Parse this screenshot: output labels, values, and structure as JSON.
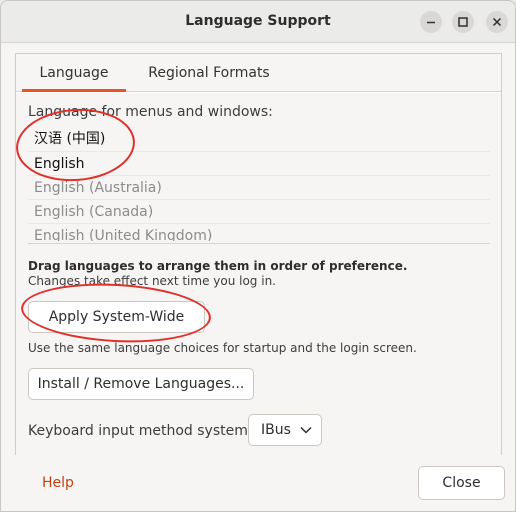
{
  "window": {
    "title": "Language Support",
    "controls": [
      "minimize-icon",
      "maximize-icon",
      "close-icon"
    ]
  },
  "tabs": [
    {
      "label": "Language",
      "selected": true
    },
    {
      "label": "Regional Formats",
      "selected": false
    }
  ],
  "language_tab": {
    "list_label": "Language for menus and windows:",
    "languages": [
      {
        "label": "汉语 (中国)",
        "active": true
      },
      {
        "label": "English",
        "active": true
      },
      {
        "label": "English (Australia)",
        "active": false
      },
      {
        "label": "English (Canada)",
        "active": false
      },
      {
        "label": "English (United Kingdom)",
        "active": false
      }
    ],
    "drag_hint": "Drag languages to arrange them in order of preference.",
    "effect_hint": "Changes take effect next time you log in.",
    "apply_button": "Apply System-Wide",
    "apply_hint": "Use the same language choices for startup and the login screen.",
    "install_button": "Install / Remove Languages...",
    "keyboard_label": "Keyboard input method system:",
    "keyboard_value": "IBus"
  },
  "footer": {
    "help_label": "Help",
    "close_label": "Close"
  },
  "colors": {
    "accent": "#e95420",
    "help_link": "#c34113",
    "annotation": "#e0302a"
  }
}
